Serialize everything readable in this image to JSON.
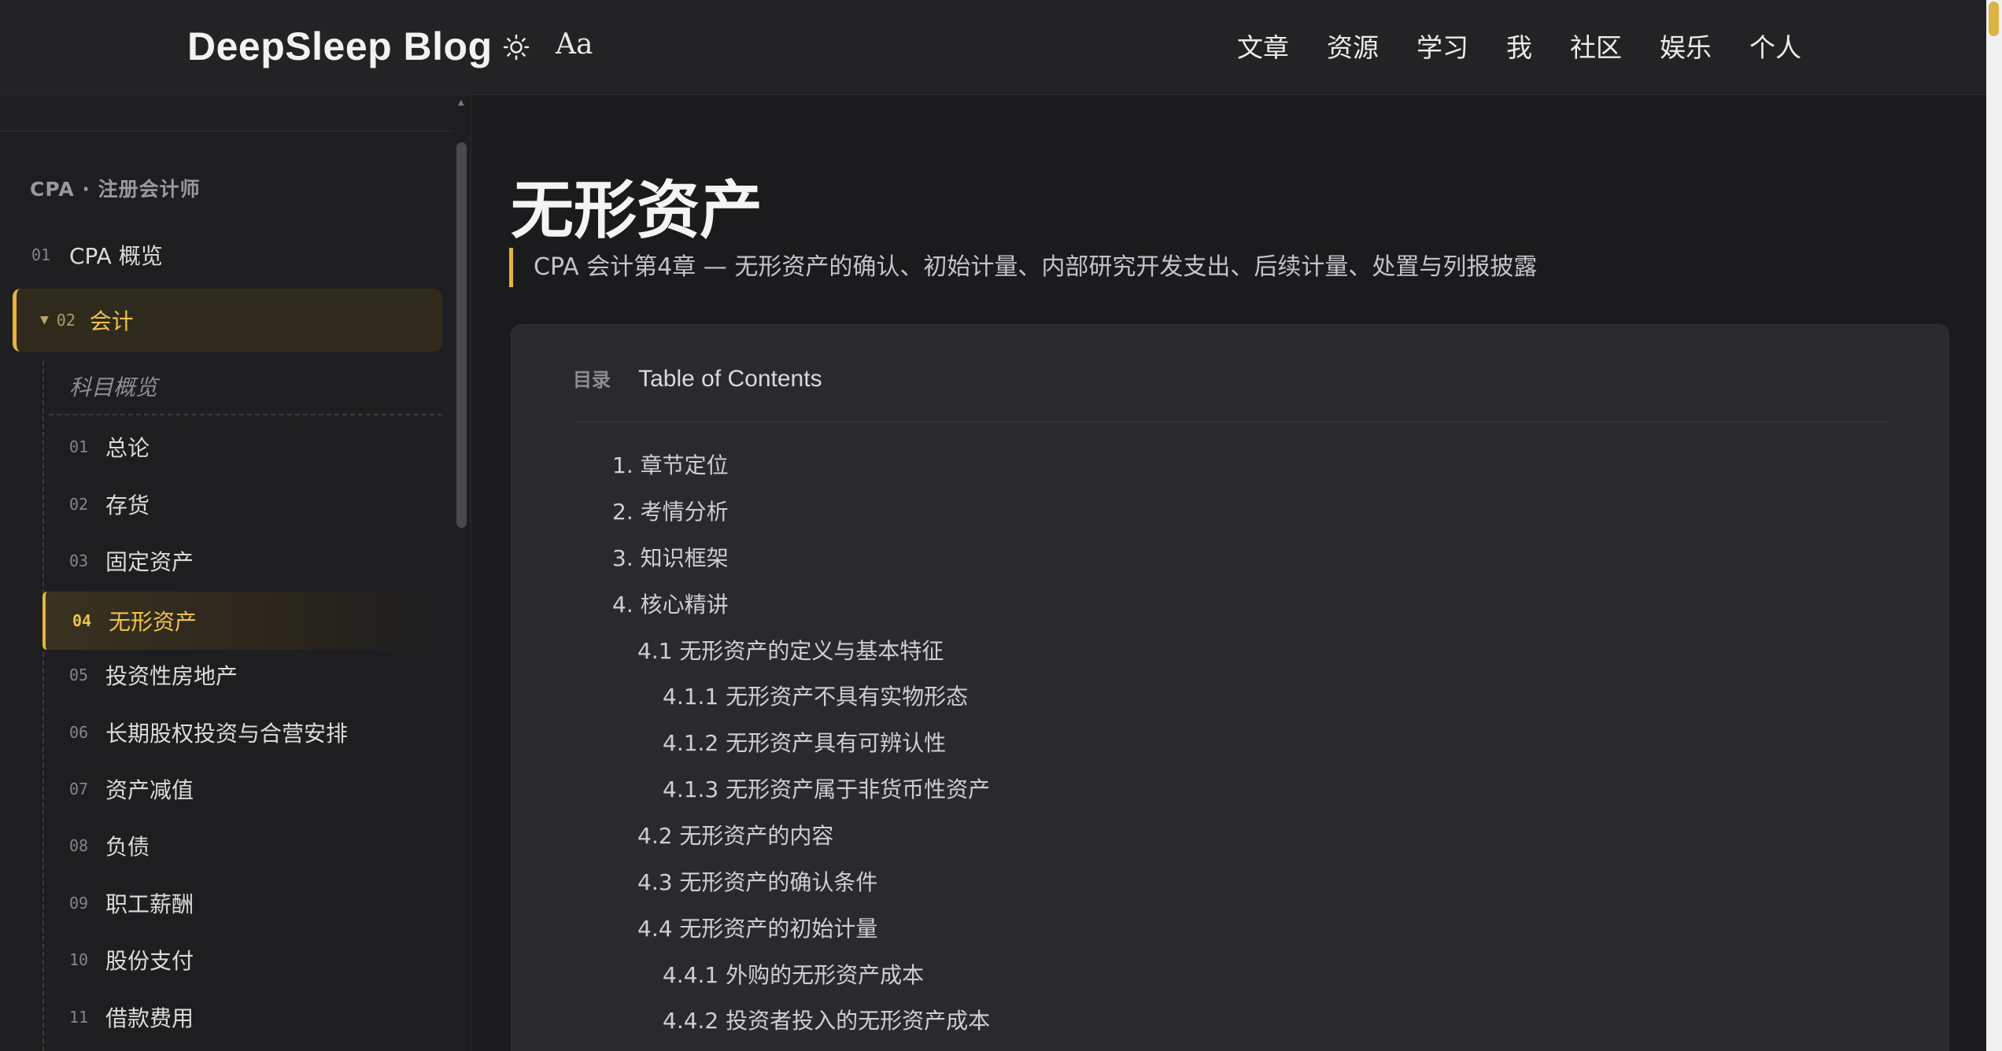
{
  "header": {
    "brand": "DeepSleep Blog",
    "theme_icon": "sun-icon",
    "font_toggle": "Aa",
    "nav": [
      "文章",
      "资源",
      "学习",
      "我",
      "社区",
      "娱乐",
      "个人"
    ]
  },
  "sidebar": {
    "section_title": "CPA · 注册会计师",
    "overview": {
      "num": "01",
      "label": "CPA 概览"
    },
    "accounting": {
      "num": "02",
      "label": "会计",
      "expanded": true
    },
    "subject_overview": "科目概览",
    "chapters": [
      {
        "num": "01",
        "label": "总论"
      },
      {
        "num": "02",
        "label": "存货"
      },
      {
        "num": "03",
        "label": "固定资产"
      },
      {
        "num": "04",
        "label": "无形资产"
      },
      {
        "num": "05",
        "label": "投资性房地产"
      },
      {
        "num": "06",
        "label": "长期股权投资与合营安排"
      },
      {
        "num": "07",
        "label": "资产减值"
      },
      {
        "num": "08",
        "label": "负债"
      },
      {
        "num": "09",
        "label": "职工薪酬"
      },
      {
        "num": "10",
        "label": "股份支付"
      },
      {
        "num": "11",
        "label": "借款费用"
      }
    ],
    "active_chapter": "04"
  },
  "main": {
    "title": "无形资产",
    "subtitle": "CPA 会计第4章 — 无形资产的确认、初始计量、内部研究开发支出、后续计量、处置与列报披露",
    "toc": {
      "tag": "目录",
      "title": "Table of Contents",
      "items": [
        {
          "level": 1,
          "text": "1. 章节定位"
        },
        {
          "level": 1,
          "text": "2. 考情分析"
        },
        {
          "level": 1,
          "text": "3. 知识框架"
        },
        {
          "level": 1,
          "text": "4. 核心精讲"
        },
        {
          "level": 2,
          "text": "4.1 无形资产的定义与基本特征"
        },
        {
          "level": 3,
          "text": "4.1.1 无形资产不具有实物形态"
        },
        {
          "level": 3,
          "text": "4.1.2 无形资产具有可辨认性"
        },
        {
          "level": 3,
          "text": "4.1.3 无形资产属于非货币性资产"
        },
        {
          "level": 2,
          "text": "4.2 无形资产的内容"
        },
        {
          "level": 2,
          "text": "4.3 无形资产的确认条件"
        },
        {
          "level": 2,
          "text": "4.4 无形资产的初始计量"
        },
        {
          "level": 3,
          "text": "4.4.1 外购的无形资产成本"
        },
        {
          "level": 3,
          "text": "4.4.2 投资者投入的无形资产成本"
        }
      ]
    }
  },
  "colors": {
    "accent": "#e4b53a",
    "background": "#1b1b1d",
    "header": "#232325",
    "toc_card": "#2a2a2d"
  }
}
